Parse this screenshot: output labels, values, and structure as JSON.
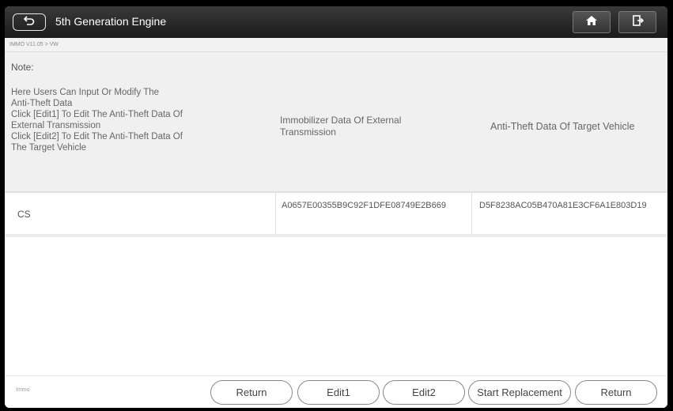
{
  "header": {
    "title": "5th Generation Engine",
    "back_icon": "back-icon",
    "home_icon": "home-icon",
    "exit_icon": "exit-icon"
  },
  "breadcrumb": "IMMO V11.05 > VW",
  "note": {
    "label": "Note:",
    "text": "Here Users Can Input Or Modify The\nAnti-Theft Data\nClick [Edit1] To Edit The Anti-Theft Data Of\nExternal Transmission\nClick [Edit2] To Edit The Anti-Theft Data Of\nThe Target Vehicle"
  },
  "table": {
    "columns": [
      "Immobilizer Data Of External\nTransmission",
      "Anti-Theft Data Of Target Vehicle"
    ],
    "rows": [
      {
        "name": "CS",
        "external": "A0657E00355B9C92F1DFE08749E2B669",
        "target": "D5F8238AC05B470A81E3CF6A1E803D19"
      }
    ]
  },
  "footer": {
    "status": "Immo",
    "buttons": [
      "Return",
      "Edit1",
      "Edit2",
      "Start Replacement",
      "Return"
    ]
  }
}
